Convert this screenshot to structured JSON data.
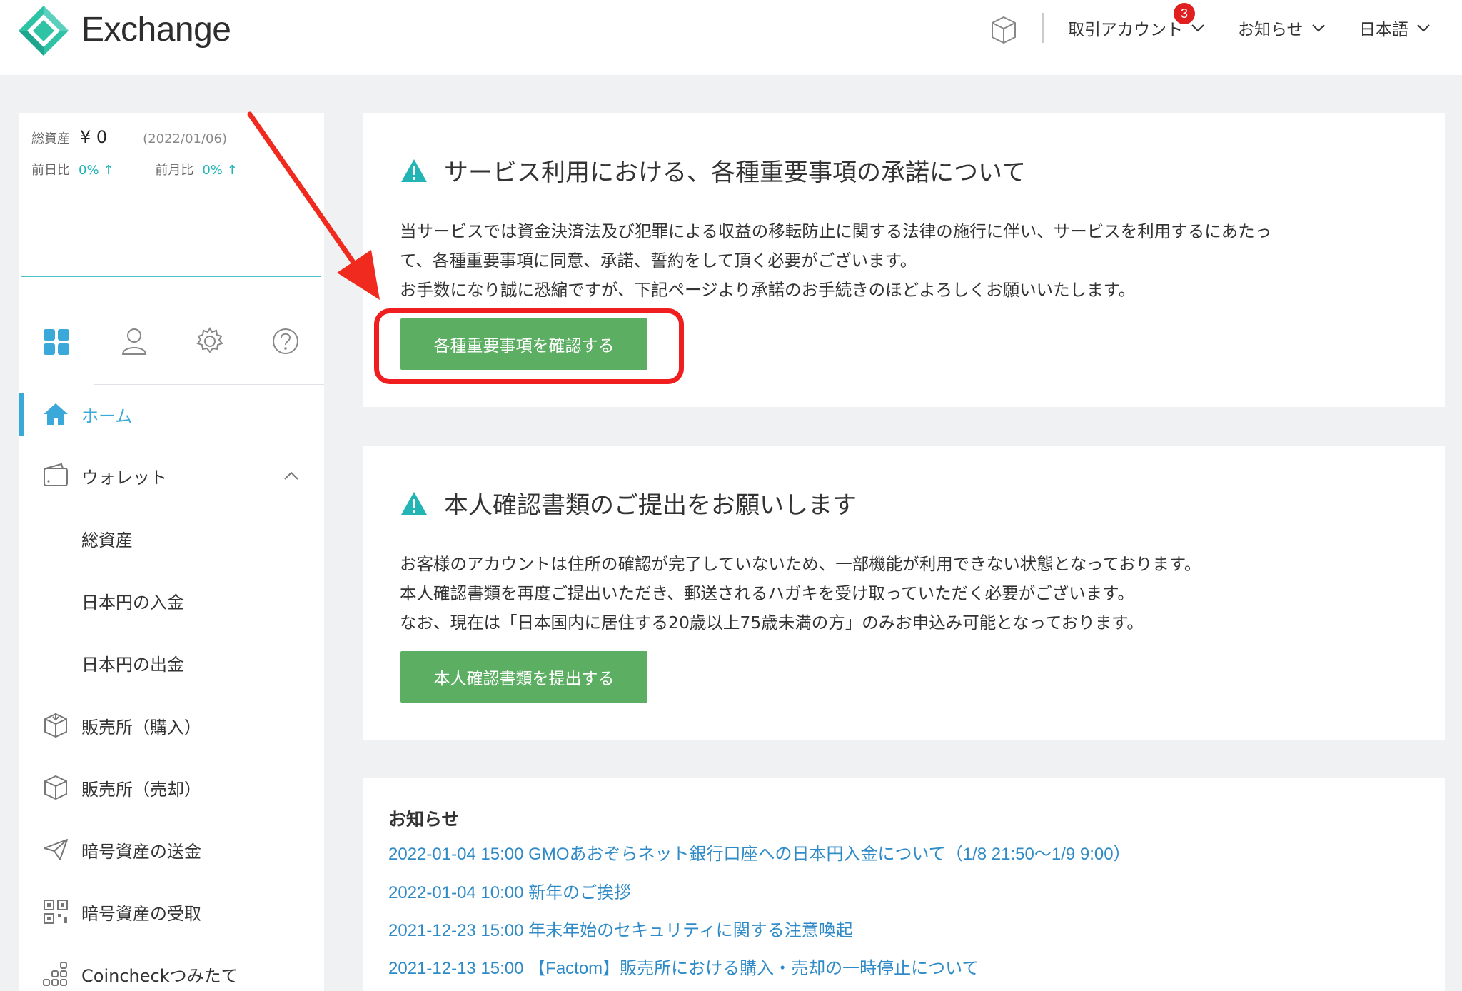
{
  "header": {
    "brand": "Exchange",
    "nav": [
      {
        "label": "取引アカウント",
        "badge": "3"
      },
      {
        "label": "お知らせ"
      },
      {
        "label": "日本語"
      }
    ]
  },
  "sidebar": {
    "summary": {
      "total_label": "総資産",
      "total_value": "¥ 0",
      "date": "(2022/01/06)",
      "day_label": "前日比",
      "day_value": "0% ↑",
      "month_label": "前月比",
      "month_value": "0% ↑"
    },
    "menu": [
      {
        "label": "ホーム",
        "icon": "home-icon",
        "active": true
      },
      {
        "label": "ウォレット",
        "icon": "wallet-icon"
      },
      {
        "label": "総資産"
      },
      {
        "label": "日本円の入金"
      },
      {
        "label": "日本円の出金"
      },
      {
        "label": "販売所（購入）",
        "icon": "box-in-icon"
      },
      {
        "label": "販売所（売却）",
        "icon": "box-out-icon"
      },
      {
        "label": "暗号資産の送金",
        "icon": "send-icon"
      },
      {
        "label": "暗号資産の受取",
        "icon": "qr-icon"
      },
      {
        "label": "Coincheckつみたて",
        "icon": "dots-icon"
      }
    ]
  },
  "cards": {
    "consent": {
      "title": "サービス利用における、各種重要事項の承諾について",
      "lines": [
        "当サービスでは資金決済法及び犯罪による収益の移転防止に関する法律の施行に伴い、サービスを利用するにあたっ",
        "て、各種重要事項に同意、承諾、誓約をして頂く必要がございます。",
        "お手数になり誠に恐縮ですが、下記ページより承諾のお手続きのほどよろしくお願いいたします。"
      ],
      "button": "各種重要事項を確認する"
    },
    "identity": {
      "title": "本人確認書類のご提出をお願いします",
      "lines": [
        "お客様のアカウントは住所の確認が完了していないため、一部機能が利用できない状態となっております。",
        "本人確認書類を再度ご提出いただき、郵送されるハガキを受け取っていただく必要がございます。",
        "なお、現在は「日本国内に居住する20歳以上75歳未満の方」のみお申込み可能となっております。"
      ],
      "button": "本人確認書類を提出する"
    },
    "news": {
      "title": "お知らせ",
      "items": [
        "2022-01-04 15:00 GMOあおぞらネット銀行口座への日本円入金について（1/8 21:50〜1/9 9:00）",
        "2022-01-04 10:00 新年のご挨拶",
        "2021-12-23 15:00 年末年始のセキュリティに関する注意喚起",
        "2021-12-13 15:00 【Factom】販売所における購入・売却の一時停止について"
      ]
    }
  },
  "colors": {
    "accent": "#3aa8d8",
    "button": "#5cae62",
    "link": "#2f8bc7",
    "highlight": "#f01e1e",
    "teal": "#23b5b5"
  }
}
